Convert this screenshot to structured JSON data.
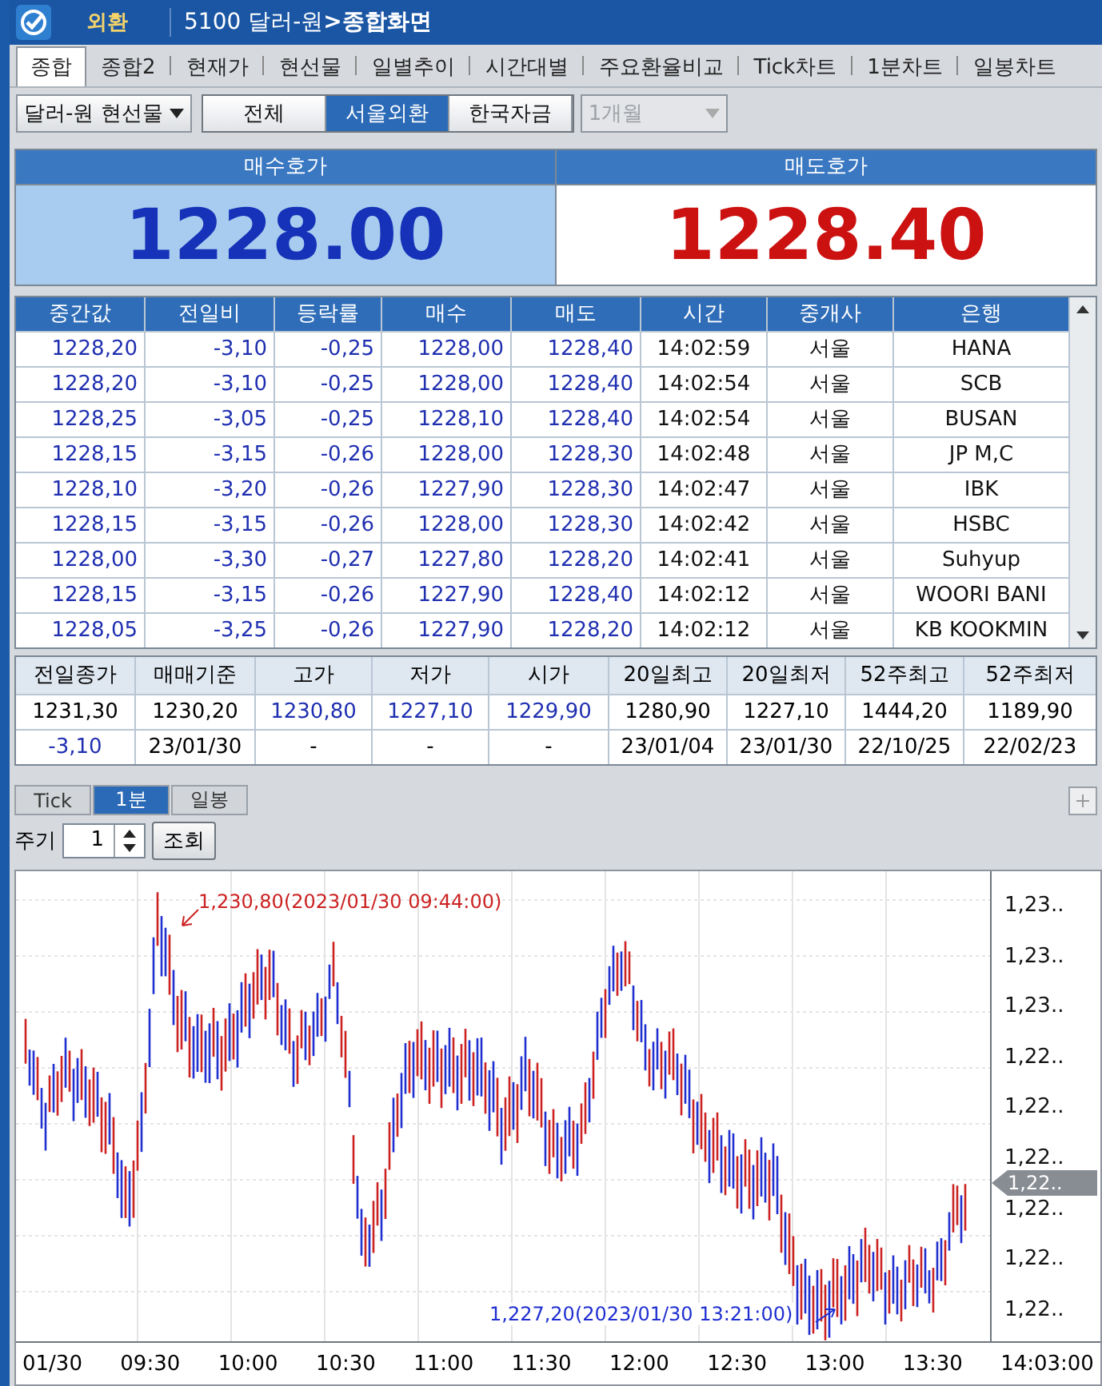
{
  "title_bar": {
    "logo": "외환",
    "breadcrumb": "5100 달러-원",
    "separator": ">",
    "screen_title": "종합화면"
  },
  "tabs": [
    {
      "label": "종합",
      "selected": true
    },
    {
      "label": "종합2",
      "selected": false
    },
    {
      "label": "현재가",
      "selected": false
    },
    {
      "label": "현선물",
      "selected": false
    },
    {
      "label": "일별추이",
      "selected": false
    },
    {
      "label": "시간대별",
      "selected": false
    },
    {
      "label": "주요환율비교",
      "selected": false
    },
    {
      "label": "Tick차트",
      "selected": false
    },
    {
      "label": "1분차트",
      "selected": false
    },
    {
      "label": "일봉차트",
      "selected": false
    }
  ],
  "toolbar": {
    "instrument": "달러-원 현선물",
    "segments": [
      {
        "label": "전체",
        "selected": false
      },
      {
        "label": "서울외환",
        "selected": true
      },
      {
        "label": "한국자금",
        "selected": false
      }
    ],
    "period": {
      "value": "1개월",
      "disabled": true
    }
  },
  "quote": {
    "bid": {
      "label": "매수호가",
      "value": "1228.00"
    },
    "ask": {
      "label": "매도호가",
      "value": "1228.40"
    }
  },
  "ticks": {
    "columns": [
      "중간값",
      "전일비",
      "등락률",
      "매수",
      "매도",
      "시간",
      "중개사",
      "은행"
    ],
    "rows": [
      [
        "1228,20",
        "-3,10",
        "-0,25",
        "1228,00",
        "1228,40",
        "14:02:59",
        "서울",
        "HANA"
      ],
      [
        "1228,20",
        "-3,10",
        "-0,25",
        "1228,00",
        "1228,40",
        "14:02:54",
        "서울",
        "SCB"
      ],
      [
        "1228,25",
        "-3,05",
        "-0,25",
        "1228,10",
        "1228,40",
        "14:02:54",
        "서울",
        "BUSAN"
      ],
      [
        "1228,15",
        "-3,15",
        "-0,26",
        "1228,00",
        "1228,30",
        "14:02:48",
        "서울",
        "JP M,C"
      ],
      [
        "1228,10",
        "-3,20",
        "-0,26",
        "1227,90",
        "1228,30",
        "14:02:47",
        "서울",
        "IBK"
      ],
      [
        "1228,15",
        "-3,15",
        "-0,26",
        "1228,00",
        "1228,30",
        "14:02:42",
        "서울",
        "HSBC"
      ],
      [
        "1228,00",
        "-3,30",
        "-0,27",
        "1227,80",
        "1228,20",
        "14:02:41",
        "서울",
        "Suhyup"
      ],
      [
        "1228,15",
        "-3,15",
        "-0,26",
        "1227,90",
        "1228,40",
        "14:02:12",
        "서울",
        "WOORI BANI"
      ],
      [
        "1228,05",
        "-3,25",
        "-0,26",
        "1227,90",
        "1228,20",
        "14:02:12",
        "서울",
        "KB KOOKMIN"
      ]
    ]
  },
  "summary": {
    "columns": [
      "전일종가",
      "매매기준",
      "고가",
      "저가",
      "시가",
      "20일최고",
      "20일최저",
      "52주최고",
      "52주최저"
    ],
    "rows": [
      [
        {
          "text": "1231,30",
          "color": "#000000"
        },
        {
          "text": "1230,20",
          "color": "#000000"
        },
        {
          "text": "1230,80",
          "color": "#1f2fb0"
        },
        {
          "text": "1227,10",
          "color": "#1f2fb0"
        },
        {
          "text": "1229,90",
          "color": "#1f2fb0"
        },
        {
          "text": "1280,90",
          "color": "#000000"
        },
        {
          "text": "1227,10",
          "color": "#000000"
        },
        {
          "text": "1444,20",
          "color": "#000000"
        },
        {
          "text": "1189,90",
          "color": "#000000"
        }
      ],
      [
        {
          "text": "-3,10",
          "color": "#1f2fb0"
        },
        {
          "text": "23/01/30",
          "color": "#000000"
        },
        {
          "text": "-",
          "color": "#000000"
        },
        {
          "text": "-",
          "color": "#000000"
        },
        {
          "text": "-",
          "color": "#000000"
        },
        {
          "text": "23/01/04",
          "color": "#000000"
        },
        {
          "text": "23/01/30",
          "color": "#000000"
        },
        {
          "text": "22/10/25",
          "color": "#000000"
        },
        {
          "text": "22/02/23",
          "color": "#000000"
        }
      ]
    ]
  },
  "chart_tabs": [
    {
      "label": "Tick",
      "selected": false
    },
    {
      "label": "1분",
      "selected": true
    },
    {
      "label": "일봉",
      "selected": false
    }
  ],
  "period": {
    "label": "주기",
    "value": "1",
    "button": "조회"
  },
  "chart": {
    "y_labels": [
      "1,23..",
      "1,23..",
      "1,23..",
      "1,22..",
      "1,22..",
      "1,22..",
      "1,22..",
      "1,22..",
      "1,22.."
    ],
    "current": "1,22..",
    "x_labels": [
      "01/30",
      "09:30",
      "10:00",
      "10:30",
      "11:00",
      "11:30",
      "12:00",
      "12:30",
      "13:00",
      "13:30",
      "14:03:00"
    ],
    "high_note": "1,230,80(2023/01/30 09:44:00)",
    "low_note": "1,227,20(2023/01/30 13:21:00)"
  }
}
